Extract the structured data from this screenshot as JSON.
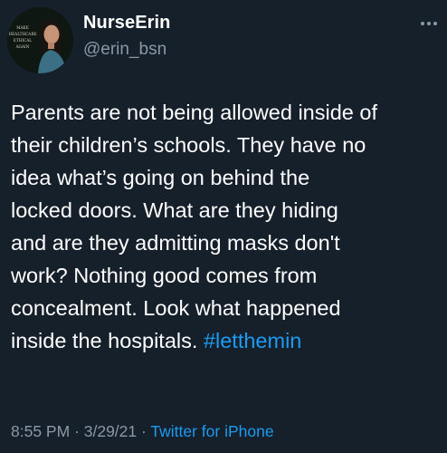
{
  "author": {
    "display_name": "NurseErin",
    "handle": "@erin_bsn",
    "avatar_lines": [
      "MAKE",
      "HEALTHCARE",
      "ETHICAL",
      "AGAIN"
    ]
  },
  "more_menu": {
    "icon": "more-horizontal-icon"
  },
  "tweet": {
    "lines": [
      "Parents are not being allowed inside of",
      "their children’s schools.  They have no",
      "idea what’s going on behind the",
      "locked doors.  What are they hiding",
      "and are they admitting masks don't",
      "work?  Nothing good comes from",
      "concealment.  Look what happened",
      "inside the hospitals. "
    ],
    "hashtag": "#letthemin"
  },
  "meta": {
    "time": "8:55 PM",
    "separator": " · ",
    "date": "3/29/21",
    "source": "Twitter for iPhone"
  },
  "colors": {
    "background": "#15202b",
    "text": "#ffffff",
    "secondary": "#8b98a5",
    "link": "#1d9bf0"
  }
}
